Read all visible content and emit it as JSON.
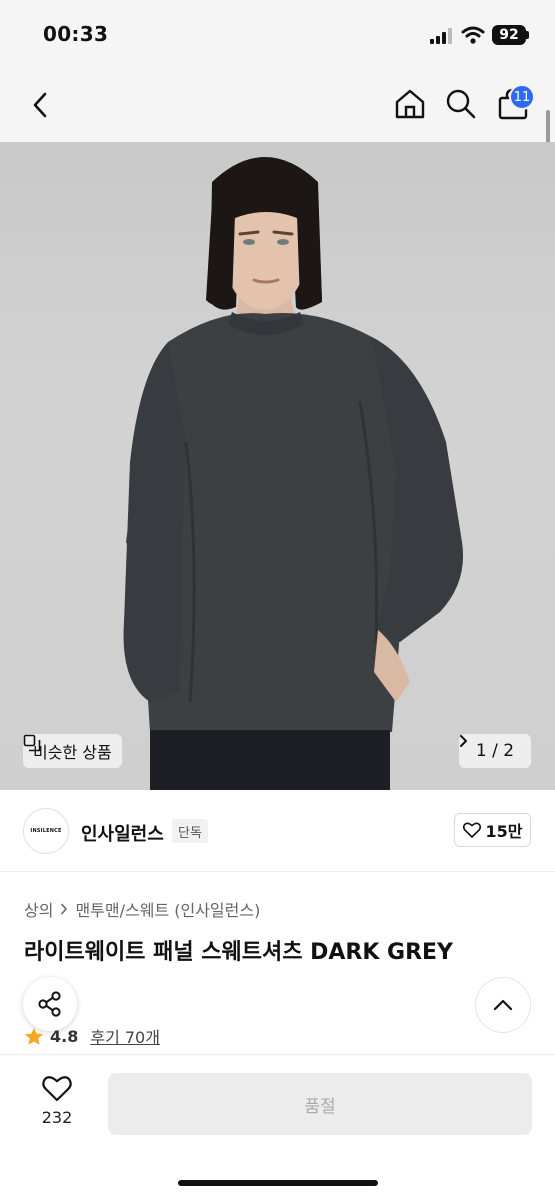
{
  "status_bar": {
    "time": "00:33",
    "battery": "92"
  },
  "nav": {
    "cart_count": "11"
  },
  "hero": {
    "similar_label": "비슷한 상품",
    "page_indicator": "1 / 2"
  },
  "brand": {
    "logo_text": "INSILENCE",
    "name": "인사일런스",
    "badge": "단독",
    "likes": "15만"
  },
  "product": {
    "breadcrumb": [
      "상의",
      "맨투맨/스웨트 (인사일런스)"
    ],
    "title": "라이트웨이트 패널 스웨트셔츠 DARK GREY",
    "rating": "4.8",
    "review_label": "후기 70개"
  },
  "bottom": {
    "wish_count": "232",
    "soldout_label": "품절"
  },
  "colors": {
    "accent_blue": "#2d6bf6",
    "star": "#f5a623",
    "sweatshirt": "#3d4043"
  },
  "icons": [
    "back-icon",
    "home-icon",
    "search-icon",
    "bag-icon",
    "share-icon",
    "chevron-up-icon",
    "heart-icon",
    "star-icon"
  ]
}
